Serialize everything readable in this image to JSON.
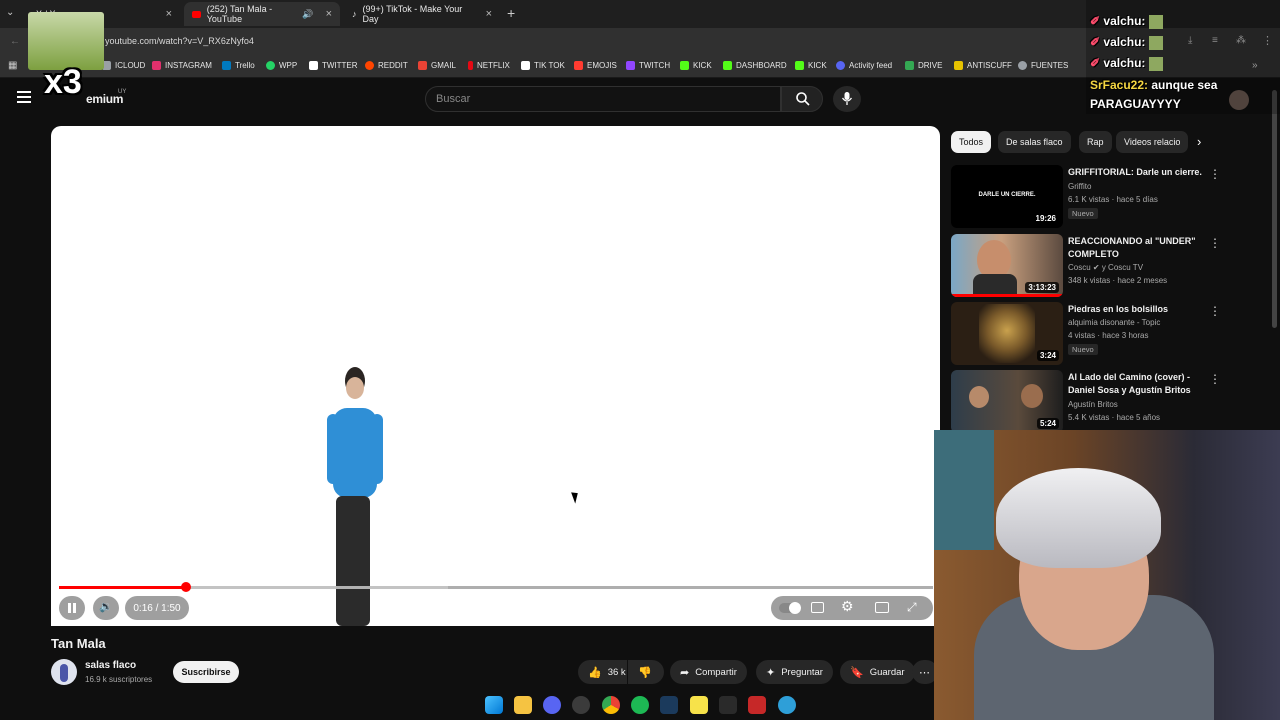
{
  "browser": {
    "tabs": [
      {
        "label": "X / X",
        "close": "×"
      },
      {
        "label": "(252) Tan Mala - YouTube",
        "close": "×"
      },
      {
        "label": "(99+) TikTok - Make Your Day",
        "close": "×"
      }
    ],
    "new_tab": "+",
    "url": "youtube.com/watch?v=V_RX6zNyfo4",
    "bookmarks": [
      {
        "label": "ICLOUD",
        "color": "#9aa0a6"
      },
      {
        "label": "INSTAGRAM",
        "color": "#e1306c"
      },
      {
        "label": "Trello",
        "color": "#0079bf"
      },
      {
        "label": "WPP",
        "color": "#25d366"
      },
      {
        "label": "TWITTER",
        "color": "#ffffff"
      },
      {
        "label": "REDDIT",
        "color": "#ff4500"
      },
      {
        "label": "GMAIL",
        "color": "#ea4335"
      },
      {
        "label": "NETFLIX",
        "color": "#e50914"
      },
      {
        "label": "TIK TOK",
        "color": "#ffffff"
      },
      {
        "label": "EMOJIS",
        "color": "#ff3b30"
      },
      {
        "label": "TWITCH",
        "color": "#9146ff"
      },
      {
        "label": "KICK",
        "color": "#53fc18"
      },
      {
        "label": "DASHBOARD",
        "color": "#53fc18"
      },
      {
        "label": "KICK",
        "color": "#53fc18"
      },
      {
        "label": "Activity feed",
        "color": "#5865f2"
      },
      {
        "label": "DRIVE",
        "color": "#34a853"
      },
      {
        "label": "ANTISCUFF",
        "color": "#e6c200"
      },
      {
        "label": "FUENTES",
        "color": "#9aa0a6"
      }
    ]
  },
  "youtube": {
    "logo_suffix": "emium",
    "logo_country": "UY",
    "search_placeholder": "Buscar",
    "video": {
      "time": "0:16 / 1:50",
      "progress": 0.145,
      "buffered": 0.445,
      "title": "Tan Mala",
      "channel": "salas flaco",
      "subscribers": "16.9 k suscriptores",
      "subscribe": "Suscribirse",
      "likes": "36 k",
      "share": "Compartir",
      "ask": "Preguntar",
      "save": "Guardar"
    },
    "chips": [
      "Todos",
      "De salas flaco",
      "Rap",
      "Videos relacio"
    ],
    "recommendations": [
      {
        "title": "GRIFFITORIAL: Darle un cierre.",
        "channel": "Griffito",
        "meta": "6.1 K vistas · hace 5 días",
        "duration": "19:26",
        "badge": "Nuevo",
        "thumb_text": "DARLE UN CIERRE."
      },
      {
        "title": "REACCIONANDO al \"UNDER\" COMPLETO",
        "channel": "Coscu ✔ y Coscu TV",
        "meta": "348 k vistas · hace 2 meses",
        "duration": "3:13:23",
        "badge": ""
      },
      {
        "title": "Piedras en los bolsillos",
        "channel": "alquimia disonante - Topic",
        "meta": "4 vistas · hace 3 horas",
        "duration": "3:24",
        "badge": "Nuevo"
      },
      {
        "title": "Al Lado del Camino (cover) - Daniel Sosa y Agustín Britos",
        "channel": "Agustín Britos",
        "meta": "5.4 K vistas · hace 5 años",
        "duration": "5:24",
        "badge": ""
      }
    ]
  },
  "overlay": {
    "chat": [
      {
        "user": "valchu:",
        "text": ""
      },
      {
        "user": "valchu:",
        "text": ""
      },
      {
        "user": "valchu:",
        "text": ""
      },
      {
        "user": "SrFacu22:",
        "text": "aunque sea"
      },
      {
        "user": "",
        "text": "PARAGUAYYYY"
      }
    ],
    "sticker_text": "x3"
  },
  "colors": {
    "accent": "#ff0000",
    "background": "#0f0f0f",
    "chip_bg": "#272727"
  }
}
